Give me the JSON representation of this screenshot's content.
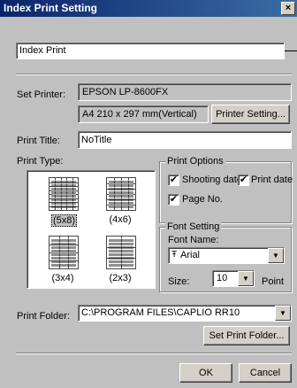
{
  "window": {
    "title": "Index Print Setting",
    "close": "×"
  },
  "header_field": {
    "value": "Index Print"
  },
  "set_printer": {
    "label": "Set Printer:",
    "printer_name": "EPSON LP-8600FX",
    "paper": "A4 210 x 297 mm(Vertical)",
    "setting_button": "Printer Setting..."
  },
  "print_title": {
    "label": "Print Title:",
    "value": "NoTitle"
  },
  "print_type": {
    "label": "Print Type:",
    "options": [
      {
        "label": "(5x8)",
        "rows": 8,
        "cols": 5,
        "selected": true
      },
      {
        "label": "(4x6)",
        "rows": 6,
        "cols": 4,
        "selected": false
      },
      {
        "label": "(3x4)",
        "rows": 4,
        "cols": 3,
        "selected": false
      },
      {
        "label": "(2x3)",
        "rows": 3,
        "cols": 2,
        "selected": false
      }
    ]
  },
  "print_options": {
    "title": "Print Options",
    "shooting_date": {
      "label": "Shooting date",
      "checked": true
    },
    "print_date": {
      "label": "Print date",
      "checked": true
    },
    "page_no": {
      "label": "Page No.",
      "checked": true
    }
  },
  "font_setting": {
    "title": "Font Setting",
    "name_label": "Font Name:",
    "font_name": "Arial",
    "font_icon": "Ŧ",
    "size_label": "Size:",
    "size_value": "10",
    "unit": "Point"
  },
  "print_folder": {
    "label": "Print Folder:",
    "value": "C:\\PROGRAM FILES\\CAPLIO RR10",
    "set_button": "Set Print Folder..."
  },
  "footer": {
    "ok": "OK",
    "cancel": "Cancel"
  },
  "icons": {
    "dropdown": "▼",
    "check": "✔"
  }
}
